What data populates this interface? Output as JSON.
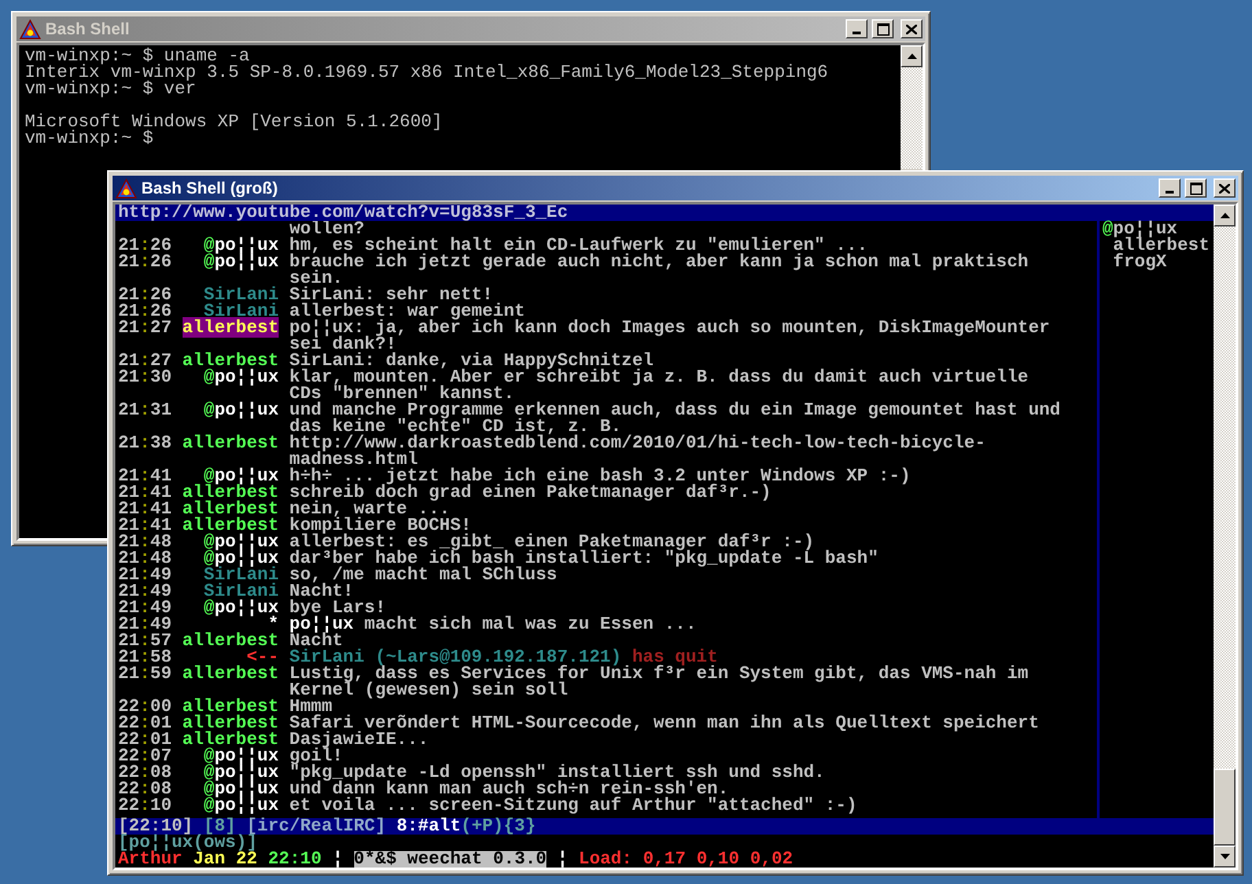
{
  "back_window": {
    "title": "Bash Shell",
    "output": [
      [
        "vm-winxp:~ $ uname -a",
        "Interix vm-winxp 3.5 SP-8.0.1969.57 x86 Intel_x86_Family6_Model23_Stepping6",
        "vm-winxp:~ $ ver"
      ],
      [
        "Microsoft Windows XP [Version 5.1.2600]",
        "vm-winxp:~ $"
      ]
    ]
  },
  "front_window": {
    "title": "Bash Shell (groß)",
    "topic": "http://www.youtube.com/watch?v=Ug83sF_3_Ec",
    "messages": [
      {
        "kind": "continuation",
        "text": "wollen?"
      },
      {
        "kind": "message",
        "time": "21:26",
        "prefix": "@",
        "nick": "po¦¦ux",
        "color": "#ffffff",
        "highlight": false,
        "text": "hm, es scheint halt ein CD-Laufwerk zu \"emulieren\" ..."
      },
      {
        "kind": "message",
        "time": "21:26",
        "prefix": "@",
        "nick": "po¦¦ux",
        "color": "#ffffff",
        "highlight": false,
        "text": "brauche ich jetzt gerade auch nicht, aber kann ja schon mal praktisch sein."
      },
      {
        "kind": "message",
        "time": "21:26",
        "nick": "SirLani",
        "color": "#2e8b8b",
        "highlight": false,
        "text": "SirLani: sehr nett!"
      },
      {
        "kind": "message",
        "time": "21:26",
        "nick": "SirLani",
        "color": "#2e8b8b",
        "highlight": false,
        "text": "allerbest: war gemeint"
      },
      {
        "kind": "message",
        "time": "21:27",
        "nick": "allerbest",
        "highlight": true,
        "text": "po¦¦ux: ja, aber ich kann doch Images auch so mounten, DiskImageMounter sei dank?!"
      },
      {
        "kind": "message",
        "time": "21:27",
        "nick": "allerbest",
        "color": "#55ff55",
        "highlight": false,
        "text": "SirLani: danke, via HappySchnitzel"
      },
      {
        "kind": "message",
        "time": "21:30",
        "prefix": "@",
        "nick": "po¦¦ux",
        "color": "#ffffff",
        "highlight": false,
        "text": "klar, mounten. Aber er schreibt ja z. B. dass du damit auch virtuelle CDs \"brennen\" kannst."
      },
      {
        "kind": "message",
        "time": "21:31",
        "prefix": "@",
        "nick": "po¦¦ux",
        "color": "#ffffff",
        "highlight": false,
        "text": "und manche Programme erkennen auch, dass du ein Image gemountet hast und das keine \"echte\" CD ist, z. B."
      },
      {
        "kind": "message",
        "time": "21:38",
        "nick": "allerbest",
        "color": "#55ff55",
        "highlight": false,
        "text": "http://www.darkroastedblend.com/2010/01/hi-tech-low-tech-bicycle-madness.html"
      },
      {
        "kind": "message",
        "time": "21:41",
        "prefix": "@",
        "nick": "po¦¦ux",
        "color": "#ffffff",
        "highlight": false,
        "text": "h÷h÷ ... jetzt habe ich eine bash 3.2 unter Windows XP :-)"
      },
      {
        "kind": "message",
        "time": "21:41",
        "nick": "allerbest",
        "color": "#55ff55",
        "highlight": false,
        "text": "schreib doch grad einen Paketmanager daf³r.-)"
      },
      {
        "kind": "message",
        "time": "21:41",
        "nick": "allerbest",
        "color": "#55ff55",
        "highlight": false,
        "text": "nein, warte ..."
      },
      {
        "kind": "message",
        "time": "21:41",
        "nick": "allerbest",
        "color": "#55ff55",
        "highlight": false,
        "text": "kompiliere BOCHS!"
      },
      {
        "kind": "message",
        "time": "21:48",
        "prefix": "@",
        "nick": "po¦¦ux",
        "color": "#ffffff",
        "highlight": false,
        "text": "allerbest: es _gibt_ einen Paketmanager daf³r :-)"
      },
      {
        "kind": "message",
        "time": "21:48",
        "prefix": "@",
        "nick": "po¦¦ux",
        "color": "#ffffff",
        "highlight": false,
        "text": "dar³ber habe ich bash installiert: \"pkg_update -L bash\""
      },
      {
        "kind": "message",
        "time": "21:49",
        "nick": "SirLani",
        "color": "#2e8b8b",
        "highlight": false,
        "text": "so, /me macht mal SChluss"
      },
      {
        "kind": "message",
        "time": "21:49",
        "nick": "SirLani",
        "color": "#2e8b8b",
        "highlight": false,
        "text": "Nacht!"
      },
      {
        "kind": "message",
        "time": "21:49",
        "prefix": "@",
        "nick": "po¦¦ux",
        "color": "#ffffff",
        "highlight": false,
        "text": "bye Lars!"
      },
      {
        "kind": "action",
        "time": "21:49",
        "marker": "*",
        "nick": "po¦¦ux",
        "text": "macht sich mal was zu Essen ..."
      },
      {
        "kind": "message",
        "time": "21:57",
        "nick": "allerbest",
        "color": "#55ff55",
        "highlight": false,
        "text": "Nacht"
      },
      {
        "kind": "quit",
        "time": "21:58",
        "marker": "<--",
        "nick": "SirLani",
        "host": "(~Lars@109.192.187.121)",
        "text": "has quit"
      },
      {
        "kind": "message",
        "time": "21:59",
        "nick": "allerbest",
        "color": "#55ff55",
        "highlight": false,
        "text": "Lustig, dass es Services for Unix f³r ein System gibt, das VMS-nah im Kernel (gewesen) sein soll"
      },
      {
        "kind": "message",
        "time": "22:00",
        "nick": "allerbest",
        "color": "#55ff55",
        "highlight": false,
        "text": "Hmmm"
      },
      {
        "kind": "message",
        "time": "22:01",
        "nick": "allerbest",
        "color": "#55ff55",
        "highlight": false,
        "text": "Safari verõndert HTML-Sourcecode, wenn man ihn als Quelltext speichert"
      },
      {
        "kind": "message",
        "time": "22:01",
        "nick": "allerbest",
        "color": "#55ff55",
        "highlight": false,
        "text": "DasjawieIE..."
      },
      {
        "kind": "message",
        "time": "22:07",
        "prefix": "@",
        "nick": "po¦¦ux",
        "color": "#ffffff",
        "highlight": false,
        "text": "goil!"
      },
      {
        "kind": "message",
        "time": "22:08",
        "prefix": "@",
        "nick": "po¦¦ux",
        "color": "#ffffff",
        "highlight": false,
        "text": "\"pkg_update -Ld openssh\" installiert ssh und sshd."
      },
      {
        "kind": "message",
        "time": "22:08",
        "prefix": "@",
        "nick": "po¦¦ux",
        "color": "#ffffff",
        "highlight": false,
        "text": "und dann kann man auch sch÷n rein-ssh'en."
      },
      {
        "kind": "message",
        "time": "22:10",
        "prefix": "@",
        "nick": "po¦¦ux",
        "color": "#ffffff",
        "highlight": false,
        "text": "et voila ... screen-Sitzung auf Arthur \"attached\" :-)"
      }
    ],
    "nicklist": [
      {
        "prefix": "@",
        "nick": "po¦¦ux"
      },
      {
        "nick": "allerbest"
      },
      {
        "nick": "frogX"
      }
    ],
    "status_line": {
      "time": "[22:10]",
      "window_number": "[8]",
      "server": "[irc/RealIRC]",
      "channel": "8:#alt",
      "modes": "(+P){3}"
    },
    "input": {
      "prompt": "[po¦¦ux(ows)]"
    },
    "hardstatus": {
      "host": "Arthur",
      "date": "Jan 22",
      "time": "22:10",
      "separators": [
        "¦",
        "¦"
      ],
      "window": "0*&$ weechat 0.3.0",
      "load": "Load: 0,17 0,10 0,02"
    }
  }
}
